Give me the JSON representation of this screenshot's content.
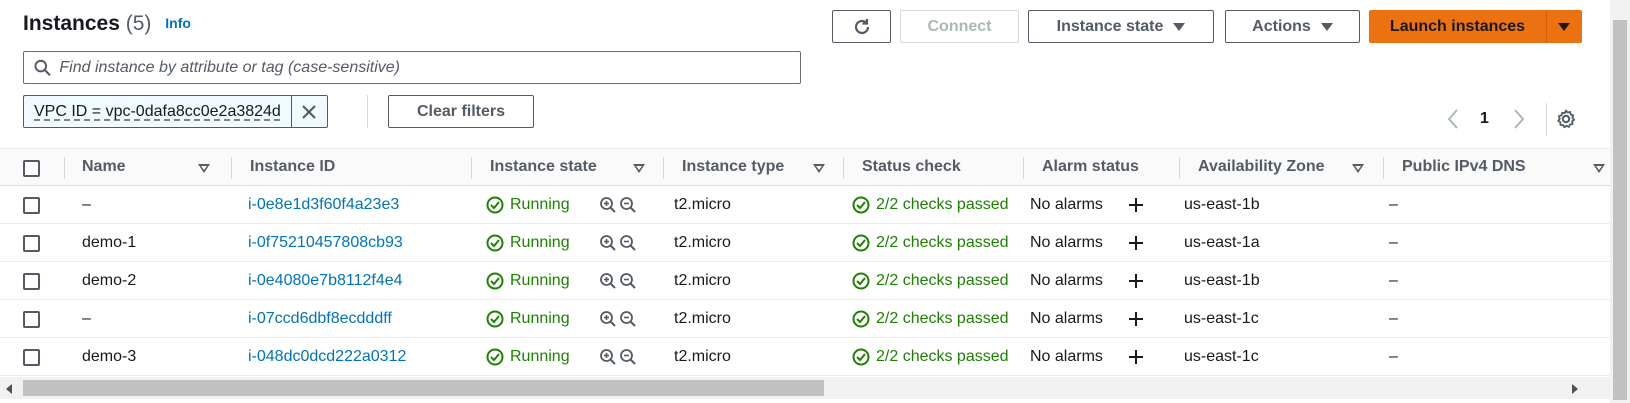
{
  "header": {
    "title": "Instances",
    "count": "(5)",
    "info": "Info"
  },
  "toolbar": {
    "connect": "Connect",
    "instance_state": "Instance state",
    "actions": "Actions",
    "launch": "Launch instances"
  },
  "search": {
    "placeholder": "Find instance by attribute or tag (case-sensitive)"
  },
  "filter": {
    "token": "VPC ID = vpc-0dafa8cc0e2a3824d",
    "clear": "Clear filters"
  },
  "pagination": {
    "page": "1"
  },
  "table": {
    "columns": {
      "name": "Name",
      "instance_id": "Instance ID",
      "instance_state": "Instance state",
      "instance_type": "Instance type",
      "status_check": "Status check",
      "alarm_status": "Alarm status",
      "availability_zone": "Availability Zone",
      "public_dns": "Public IPv4 DNS"
    },
    "rows": [
      {
        "name": "–",
        "instance_id": "i-0e8e1d3f60f4a23e3",
        "state": "Running",
        "type": "t2.micro",
        "status": "2/2 checks passed",
        "alarm": "No alarms",
        "az": "us-east-1b",
        "dns": "–"
      },
      {
        "name": "demo-1",
        "instance_id": "i-0f75210457808cb93",
        "state": "Running",
        "type": "t2.micro",
        "status": "2/2 checks passed",
        "alarm": "No alarms",
        "az": "us-east-1a",
        "dns": "–"
      },
      {
        "name": "demo-2",
        "instance_id": "i-0e4080e7b8112f4e4",
        "state": "Running",
        "type": "t2.micro",
        "status": "2/2 checks passed",
        "alarm": "No alarms",
        "az": "us-east-1b",
        "dns": "–"
      },
      {
        "name": "–",
        "instance_id": "i-07ccd6dbf8ecdddff",
        "state": "Running",
        "type": "t2.micro",
        "status": "2/2 checks passed",
        "alarm": "No alarms",
        "az": "us-east-1c",
        "dns": "–"
      },
      {
        "name": "demo-3",
        "instance_id": "i-048dc0dcd222a0312",
        "state": "Running",
        "type": "t2.micro",
        "status": "2/2 checks passed",
        "alarm": "No alarms",
        "az": "us-east-1c",
        "dns": "–"
      }
    ]
  },
  "colors": {
    "primary": "#ec7211",
    "link": "#0073bb",
    "success": "#1d8102"
  }
}
